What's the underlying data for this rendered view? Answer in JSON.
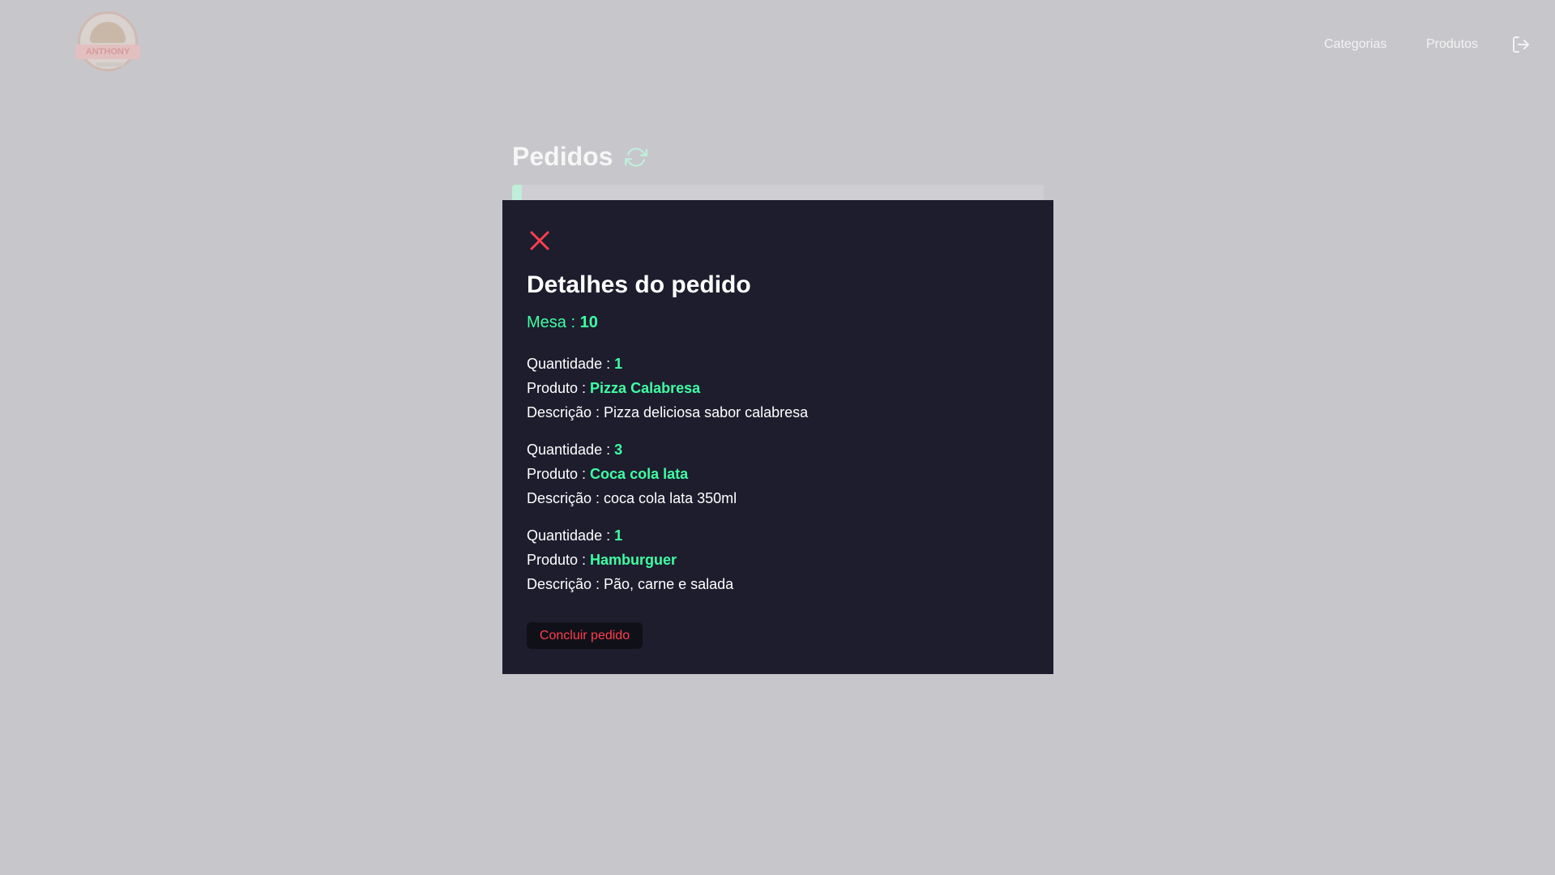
{
  "header": {
    "logo_text": "ANTHONY",
    "nav": {
      "categorias": "Categorias",
      "produtos": "Produtos"
    }
  },
  "page": {
    "title": "Pedidos"
  },
  "modal": {
    "title": "Detalhes do pedido",
    "mesa_label": "Mesa : ",
    "mesa_value": "10",
    "items": [
      {
        "quantidade_label": "Quantidade : ",
        "quantidade": "1",
        "produto_label": "Produto : ",
        "produto": "Pizza Calabresa",
        "descricao_label": "Descrição : ",
        "descricao": "Pizza deliciosa sabor calabresa"
      },
      {
        "quantidade_label": "Quantidade : ",
        "quantidade": "3",
        "produto_label": "Produto : ",
        "produto": "Coca cola lata",
        "descricao_label": "Descrição : ",
        "descricao": "coca cola lata 350ml"
      },
      {
        "quantidade_label": "Quantidade : ",
        "quantidade": "1",
        "produto_label": "Produto : ",
        "produto": "Hamburguer",
        "descricao_label": "Descrição : ",
        "descricao": "Pão, carne e salada"
      }
    ],
    "conclude_label": "Concluir pedido"
  },
  "colors": {
    "accent": "#3fffa3",
    "danger": "#ff3f4b",
    "modal_bg": "#1d1d2e",
    "backdrop": "#c7c6cb"
  },
  "icons": {
    "close": "close-icon",
    "refresh": "refresh-icon",
    "logout": "logout-icon"
  }
}
